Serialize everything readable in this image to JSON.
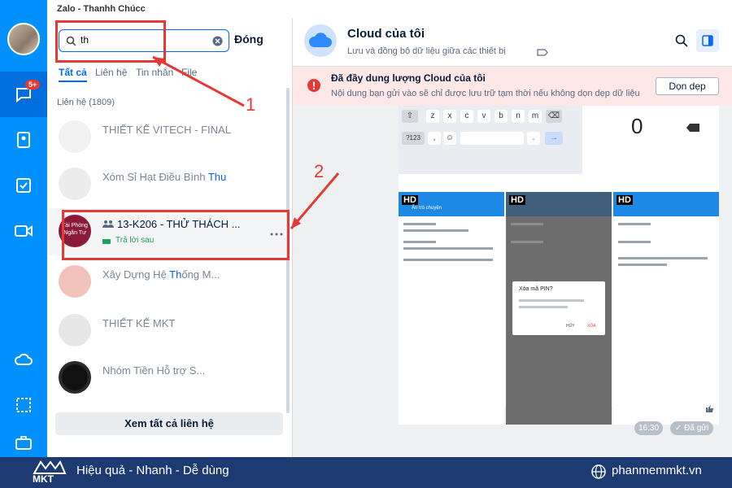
{
  "window": {
    "title": "Zalo - Thanhh Chúcc"
  },
  "rail": {
    "badge": "5+",
    "items": [
      "chat-icon",
      "contacts-icon",
      "todo-icon",
      "video-icon",
      "cloud-icon",
      "screenshot-icon",
      "briefcase-icon"
    ]
  },
  "search": {
    "value": "th",
    "placeholder": "",
    "close_label": "Đóng"
  },
  "tabs": [
    "Tất cả",
    "Liên hệ",
    "Tin nhắn",
    "File"
  ],
  "contacts": {
    "section": "Liên hệ (1809)",
    "items": [
      {
        "name_a": "THIẾT KẾ VITECH - FINAL",
        "hl": "",
        "name_b": "",
        "sub": ""
      },
      {
        "name_a": "Xóm Sỉ Hạt Điều Bình ",
        "hl": "Thu",
        "name_b": "",
        "sub": ""
      },
      {
        "name_a": "13-K206 - THỬ THÁCH ...",
        "hl": "",
        "name_b": "",
        "sub": "Trả lời sau"
      },
      {
        "name_a": "Xây Dựng Hệ ",
        "hl": "Th",
        "name_b": "ống M...",
        "sub": ""
      },
      {
        "name_a": "THIẾT KẾ MKT",
        "hl": "",
        "name_b": "",
        "sub": ""
      },
      {
        "name_a": "Nhóm Tiền Hỗ trợ S...",
        "hl": "",
        "name_b": "",
        "sub": ""
      }
    ],
    "avatar_text": "Tài Phòng Ngân Tư",
    "see_all": "Xem tất cả liên hệ"
  },
  "chat": {
    "title": "Cloud của tôi",
    "subtitle": "Lưu và đồng bộ dữ liệu giữa các thiết bị",
    "alert_title": "Đã đầy dung lượng Cloud của tôi",
    "alert_text": "Nội dung bạn gửi vào sẽ chỉ được lưu trữ tạm thời nếu không dọn dẹp dữ liệu",
    "cleanup": "Dọn dẹp",
    "time": "16:30",
    "sent": "Đã gửi",
    "zero": "0",
    "keys_row1": [
      "z",
      "x",
      "c",
      "v",
      "b",
      "n",
      "m"
    ],
    "key_num": "?123",
    "screens": {
      "hd": "HD",
      "title": "Ẩn trò chuyện",
      "dialog_title": "Xóa mã PIN?",
      "dialog_cancel": "HỦY",
      "dialog_ok": "XÓA"
    }
  },
  "annotations": {
    "one": "1",
    "two": "2"
  },
  "footer": {
    "logo": "MKT",
    "slogan": "Hiệu quả - Nhanh - Dễ dùng",
    "site": "phanmemmkt.vn"
  }
}
